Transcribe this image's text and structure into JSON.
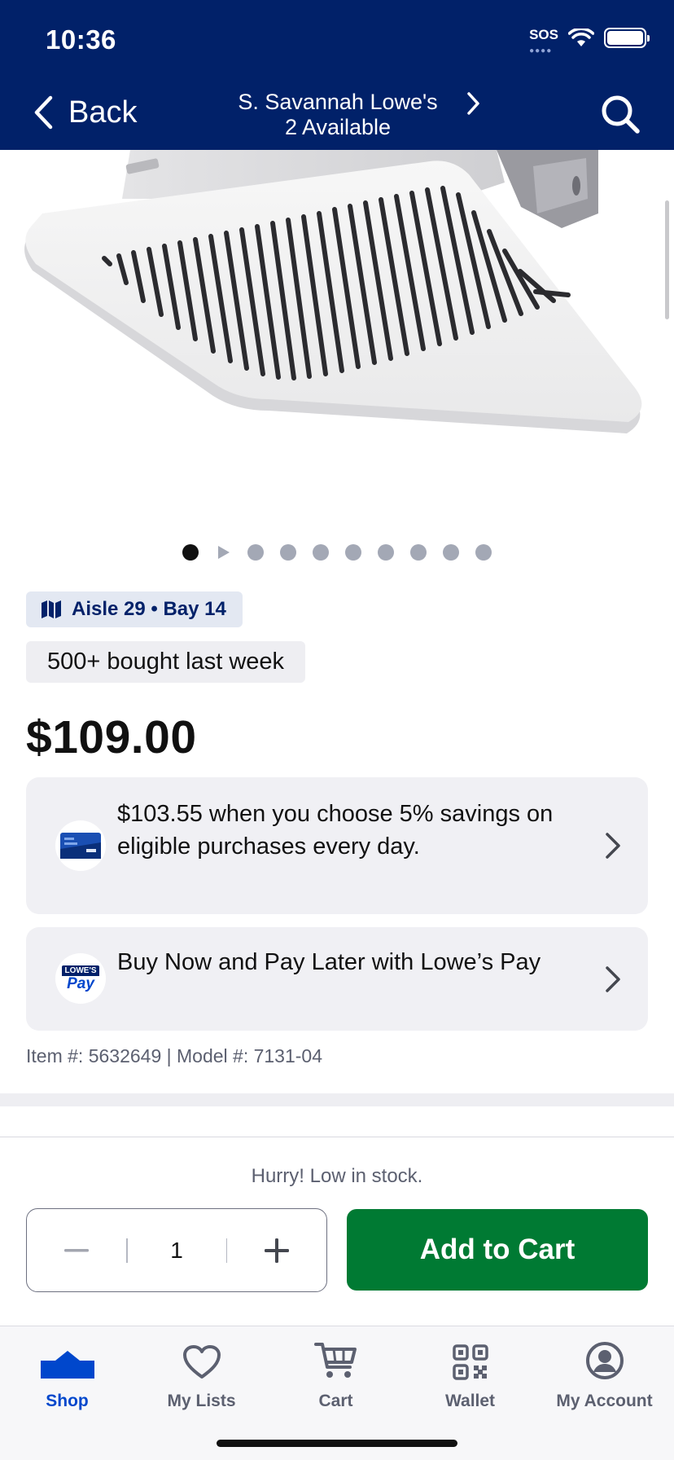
{
  "status_bar": {
    "time": "10:36",
    "sos": "SOS"
  },
  "header": {
    "back_label": "Back",
    "store_name": "S. Savannah Lowe's",
    "availability": "2 Available"
  },
  "product": {
    "image_alt": "Bathroom exhaust fan",
    "carousel": {
      "total_dots": 10,
      "active_index": 0,
      "video_index": 1
    },
    "aisle": "Aisle 29 • Bay 14",
    "social_proof": "500+ bought last week",
    "price": "$109.00",
    "promos": [
      {
        "text": "$103.55 when you choose 5% savings on eligible purchases every day.",
        "icon": "lowes-credit-card-icon"
      },
      {
        "text": "Buy Now and Pay Later with Lowe’s Pay",
        "icon": "lowes-pay-icon",
        "logo_top": "LOWE'S",
        "logo_bottom": "Pay"
      }
    ],
    "item_info": "Item #: 5632649 | Model #: 7131-04"
  },
  "purchase": {
    "stock_message": "Hurry! Low in stock.",
    "quantity": "1",
    "add_to_cart_label": "Add to Cart"
  },
  "tabs": [
    {
      "label": "Shop",
      "icon": "shop-icon",
      "active": true
    },
    {
      "label": "My Lists",
      "icon": "heart-icon",
      "active": false
    },
    {
      "label": "Cart",
      "icon": "cart-icon",
      "active": false
    },
    {
      "label": "Wallet",
      "icon": "qr-code-icon",
      "active": false
    },
    {
      "label": "My Account",
      "icon": "account-icon",
      "active": false
    }
  ],
  "colors": {
    "header_bg": "#012169",
    "add_to_cart_bg": "#007a33",
    "active_tab": "#0047cc",
    "badge_text": "#012169"
  }
}
